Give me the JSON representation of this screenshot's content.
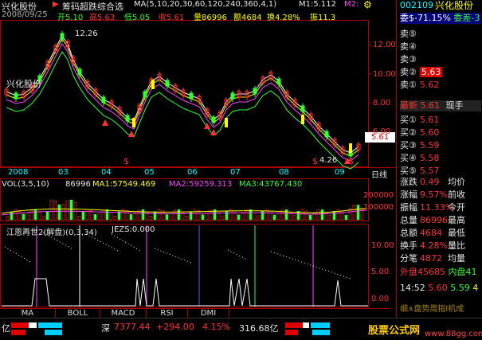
{
  "header": {
    "stock_name": "兴化股份",
    "formula": "筹码超跌综合选",
    "ma_label": "MA(5,10,20,30,60,120,240,360,4,1)",
    "m1": "M1:5.112",
    "m2": "M2:"
  },
  "ohlc_line": {
    "date": "2008/09/25",
    "open": "开5.10",
    "high": "高5.63",
    "low": "低5.05",
    "close": "收5.61",
    "volume": "量86996",
    "amount": "额4684",
    "turnover": "换4.28%",
    "amplitude": "振11.3"
  },
  "chart_labels": {
    "tag": "兴化股份",
    "peak": "12.26",
    "low": "4.26",
    "current": "5.61",
    "dollar1": "$",
    "dollar2": "$",
    "dollar3": "$",
    "daily": "日线"
  },
  "price_axis": [
    "12.00",
    "10.00",
    "8.00",
    "6.00"
  ],
  "date_axis": [
    "2008",
    "03",
    "04",
    "05",
    "06",
    "07",
    "08",
    "09"
  ],
  "vol_panel": {
    "title": "VOL(3,5,10)",
    "v1": "86996",
    "ma1": "MA1:57549.469",
    "ma2": "MA2:59259.313",
    "ma3": "MA3:43767.430",
    "axis": [
      "200000",
      "100000"
    ]
  },
  "ind_panel": {
    "title": "江恩再世2(解盘)(0,3,34)",
    "jezs": "JEZS:0.000",
    "axis": [
      "10.00",
      "5.00",
      "0.00"
    ]
  },
  "tabs": [
    "MA",
    "BOLL",
    "MACD",
    "RSI",
    "DMI"
  ],
  "right": {
    "code": "002109",
    "name": "兴化股份",
    "wb": "委$-71.15%",
    "wc": "委差-3",
    "asks": [
      [
        "卖⑤",
        ""
      ],
      [
        "卖④",
        ""
      ],
      [
        "卖③",
        ""
      ],
      [
        "卖②",
        "5.63"
      ],
      [
        "卖①",
        "5.62"
      ]
    ],
    "last_label": "最新",
    "last": "5.61",
    "hand": "现手",
    "bids": [
      [
        "买①",
        "5.61"
      ],
      [
        "买②",
        "5.60"
      ],
      [
        "买③",
        "5.59"
      ],
      [
        "买④",
        "5.58"
      ],
      [
        "买⑤",
        "5.57"
      ]
    ],
    "stats": [
      [
        "涨跌",
        "0.49",
        "均价"
      ],
      [
        "涨幅",
        "9.57%",
        "前收"
      ],
      [
        "振幅",
        "11.33%",
        "今开"
      ],
      [
        "总量",
        "86996",
        "最高"
      ],
      [
        "总额",
        "4684",
        "最低"
      ],
      [
        "换手",
        "4.28%",
        "量比"
      ],
      [
        "分笔",
        "4872",
        "均量"
      ]
    ],
    "outer_label": "外盘",
    "outer": "45685",
    "inner_label": "内盘",
    "inner": "41",
    "tick_time": "14:52",
    "tick_p1": "5.60",
    "tick_p2": "5.59",
    "tick_v": "4",
    "scroll": "细∧盘势周指l机成"
  },
  "status": {
    "left": "亿",
    "index_name": "深",
    "index": "7377.44",
    "change": "+294.00",
    "pct": "4.15%",
    "amount": "316.68亿",
    "site": "股票公式网",
    "url": "www.88gg.com"
  },
  "colors": {
    "up": "#ff3333",
    "down": "#33ff33",
    "ma5": "#ffffff",
    "ma10": "#ffff00",
    "ma20": "#ff44ff",
    "ma30": "#33ff33",
    "frame": "#aa0000"
  }
}
